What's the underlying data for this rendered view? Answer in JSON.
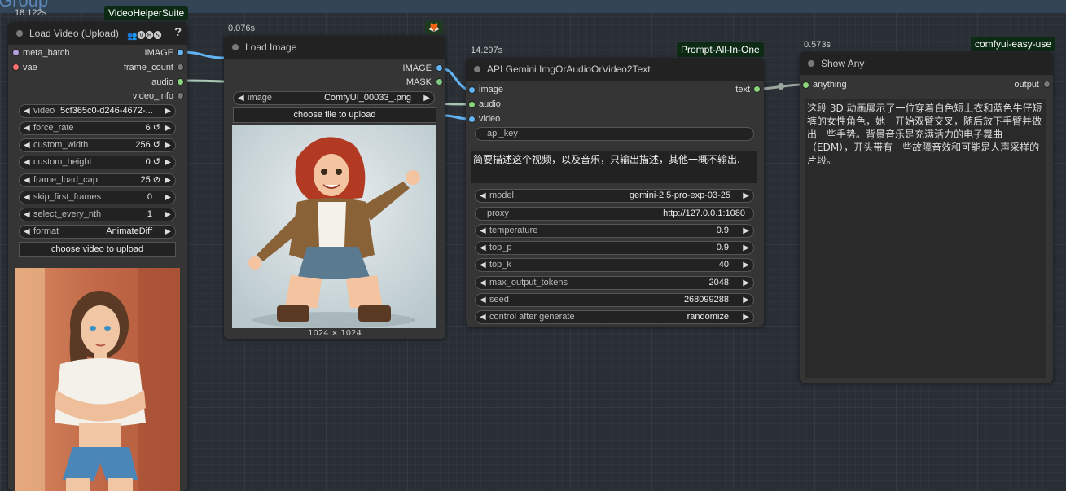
{
  "group": {
    "title": "Group"
  },
  "video_node": {
    "timing": "18.122s",
    "badge": "VideoHelperSuite",
    "title": "Load Video (Upload)",
    "title_icons": "👥🅥🅗🅢",
    "help": "?",
    "inputs": [
      "meta_batch",
      "vae"
    ],
    "outputs": [
      "IMAGE",
      "frame_count",
      "audio",
      "video_info"
    ],
    "widgets": [
      {
        "label": "video",
        "value": "5cf365c0-d246-4672-..."
      },
      {
        "label": "force_rate",
        "value": "6 ↺"
      },
      {
        "label": "custom_width",
        "value": "256 ↺"
      },
      {
        "label": "custom_height",
        "value": "0 ↺"
      },
      {
        "label": "frame_load_cap",
        "value": "25 ⊘"
      },
      {
        "label": "skip_first_frames",
        "value": "0"
      },
      {
        "label": "select_every_nth",
        "value": "1"
      },
      {
        "label": "format",
        "value": "AnimateDiff"
      }
    ],
    "upload_button": "choose video to upload",
    "preview_alt": "video preview frame"
  },
  "image_node": {
    "timing": "0.076s",
    "badge_icon": "🦊",
    "title": "Load Image",
    "outputs": [
      "IMAGE",
      "MASK"
    ],
    "widget": {
      "label": "image",
      "value": "ComfyUI_00033_.png"
    },
    "upload_button": "choose file to upload",
    "caption": "1024 × 1024"
  },
  "gemini_node": {
    "timing": "14.297s",
    "badge": "Prompt-All-In-One",
    "title": "API Gemini ImgOrAudioOrVideo2Text",
    "inputs": [
      "image",
      "audio",
      "video"
    ],
    "outputs": [
      "text"
    ],
    "api_key_label": "api_key",
    "prompt": "简要描述这个视频，以及音乐，只输出描述，其他一概不输出.",
    "widgets": [
      {
        "label": "model",
        "value": "gemini-2.5-pro-exp-03-25",
        "arrows": true
      },
      {
        "label": "proxy",
        "value": "http://127.0.0.1:1080",
        "arrows": false
      },
      {
        "label": "temperature",
        "value": "0.9",
        "arrows": true
      },
      {
        "label": "top_p",
        "value": "0.9",
        "arrows": true
      },
      {
        "label": "top_k",
        "value": "40",
        "arrows": true
      },
      {
        "label": "max_output_tokens",
        "value": "2048",
        "arrows": true
      },
      {
        "label": "seed",
        "value": "268099288",
        "arrows": true
      },
      {
        "label": "control after generate",
        "value": "randomize",
        "arrows": true
      }
    ]
  },
  "show_node": {
    "timing": "0.573s",
    "badge": "comfyui-easy-use",
    "title": "Show Any",
    "inputs": [
      "anything"
    ],
    "outputs": [
      "output"
    ],
    "text": "这段 3D 动画展示了一位穿着白色短上衣和蓝色牛仔短裤的女性角色，她一开始双臂交叉，随后放下手臂并做出一些手势。背景音乐是充满活力的电子舞曲（EDM），开头带有一些故障音效和可能是人声采样的片段。"
  },
  "colors": {
    "image_wire": "#64b5f6",
    "audio_wire": "#a9c8b5",
    "text_wire": "#9aa8a0",
    "image_dot": "#64b5f6",
    "audio_dot": "#8bd67a",
    "mask_dot": "#81c784",
    "vae_dot": "#ff6e6e",
    "latent_dot": "#b39ddb"
  }
}
